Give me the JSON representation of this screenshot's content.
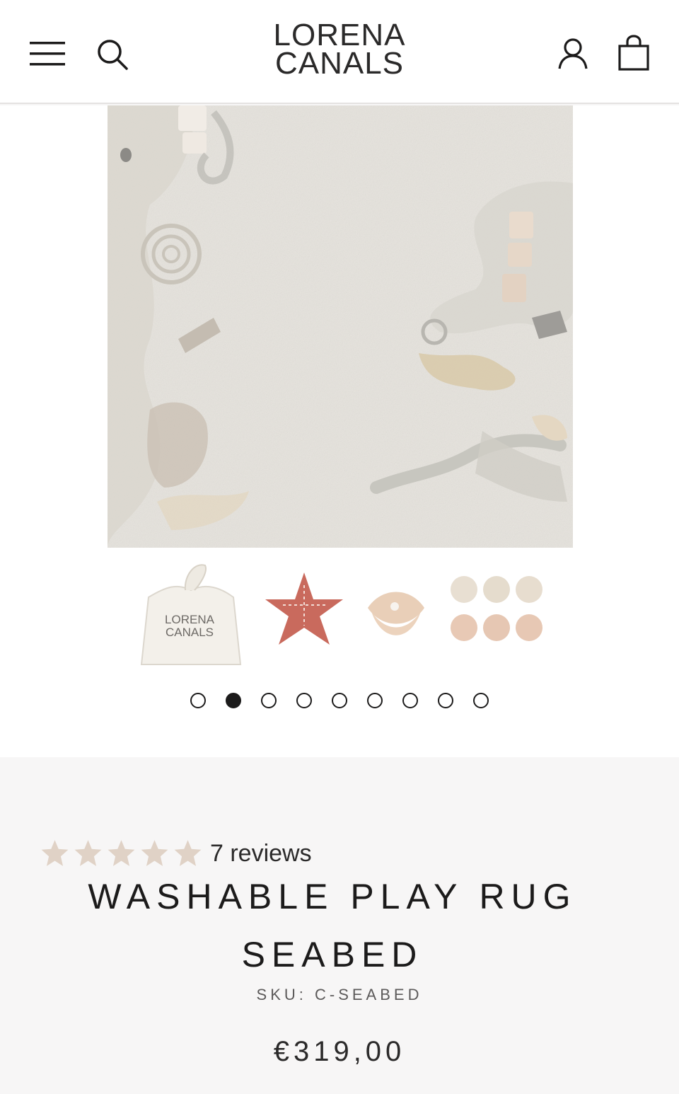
{
  "header": {
    "logo_line1": "LORENA",
    "logo_line2": "CANALS",
    "menu_icon": "hamburger-menu-icon",
    "search_icon": "search-icon",
    "account_icon": "user-account-icon",
    "cart_icon": "shopping-bag-icon"
  },
  "gallery": {
    "bag_text_line1": "LORENA",
    "bag_text_line2": "CANALS",
    "slide_count": 9,
    "active_slide": 2
  },
  "product": {
    "rating_value": 5,
    "rating_max": 5,
    "reviews_label": "7 reviews",
    "title": "WASHABLE PLAY RUG SEABED",
    "sku": "SKU: C-SEABED",
    "price": "€319,00"
  },
  "colors": {
    "star": "#e0d2c6",
    "text": "#1c1b1b",
    "rug": "#e6e3dd",
    "starfish": "#c96a5d"
  }
}
